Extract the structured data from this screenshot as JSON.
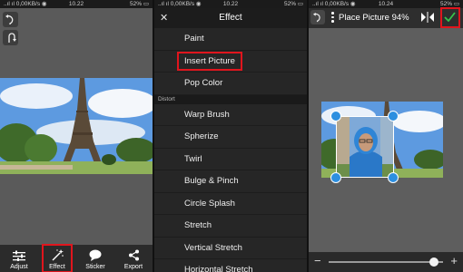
{
  "screens": [
    {
      "status": {
        "left": "..ıl ıl 0,00KB/s ◉",
        "time": "10.22",
        "battery": "52% ▭"
      },
      "toolbar": {
        "undo_icon": "undo-icon",
        "redo_icon": "redo-icon"
      },
      "bottom_nav": [
        {
          "label": "Adjust",
          "icon": "sliders-icon"
        },
        {
          "label": "Effect",
          "icon": "magic-wand-icon",
          "highlighted": true
        },
        {
          "label": "Sticker",
          "icon": "speech-bubble-icon"
        },
        {
          "label": "Export",
          "icon": "share-icon"
        }
      ]
    },
    {
      "status": {
        "left": "..ıl ıl 0,00KB/s ◉",
        "time": "10.22",
        "battery": "52% ▭"
      },
      "header": {
        "title": "Effect",
        "close_icon": "close-icon"
      },
      "menu_top": [
        "Paint",
        "Insert Picture",
        "Pop Color"
      ],
      "highlighted_item": "Insert Picture",
      "section_label": "Distort",
      "menu_distort": [
        "Warp Brush",
        "Spherize",
        "Twirl",
        "Bulge & Pinch",
        "Circle Splash",
        "Stretch",
        "Vertical Stretch",
        "Horizontal Stretch"
      ]
    },
    {
      "status": {
        "left": "..ıl ıl 0,00KB/s ◉",
        "time": "10.24",
        "battery": "52% ▭"
      },
      "header": {
        "title": "Place Picture 94%",
        "zoom_percent": 94,
        "check_highlighted": true
      },
      "slider": {
        "minus": "−",
        "plus": "+",
        "value_fraction": 0.92
      }
    }
  ],
  "colors": {
    "highlight": "#e0151d",
    "handle": "#2d8fe0",
    "sky": "#4b8fd6",
    "check": "#35c44b"
  }
}
